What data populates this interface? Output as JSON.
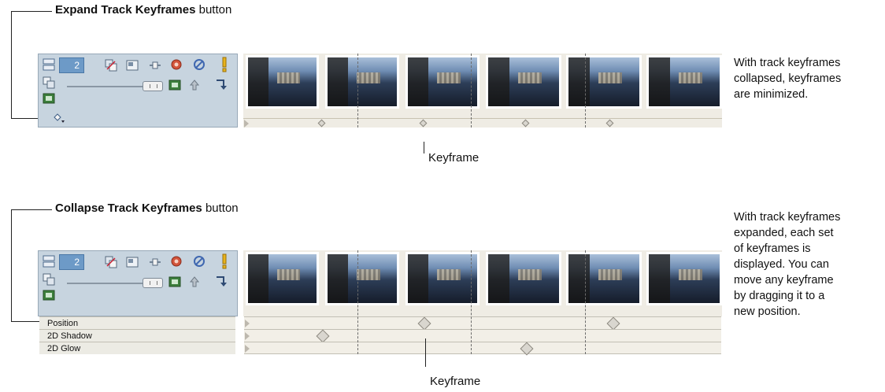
{
  "top": {
    "callout_bold": "Expand Track Keyframes",
    "callout_rest": " button",
    "track_number": "2",
    "keyframe_label": "Keyframe",
    "note": [
      "With track keyframes",
      "collapsed, keyframes",
      "are minimized."
    ]
  },
  "bottom": {
    "callout_bold": "Collapse Track Keyframes",
    "callout_rest": " button",
    "track_number": "2",
    "keyframe_label": "Keyframe",
    "lanes": [
      "Position",
      "2D Shadow",
      "2D Glow"
    ],
    "note": [
      "With track keyframes",
      "expanded, each set",
      "of keyframes is",
      "displayed. You can",
      "move any keyframe",
      "by dragging it to a",
      "new position."
    ]
  },
  "colors": {
    "header_bg": "#c7d4df",
    "track_bg": "#efece4",
    "track_number_bg": "#6d9ac7"
  },
  "icons": [
    "minimize-track-icon",
    "compositing-mode-icon",
    "track-fx-icon",
    "bypass-motion-blur-icon",
    "mute-icon",
    "solo-icon",
    "parent-compositing-icon",
    "make-compositing-child-icon",
    "track-motion-icon",
    "expand-keyframes-icon"
  ]
}
